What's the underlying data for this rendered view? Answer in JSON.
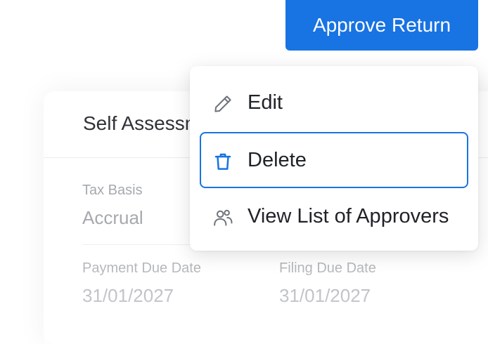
{
  "header": {
    "approve_label": "Approve Return"
  },
  "card": {
    "title": "Self Assessment",
    "fields": [
      {
        "label": "Tax Basis",
        "value": "Accrual"
      },
      {
        "label": "Payment Due Date",
        "value": "31/01/2027"
      },
      {
        "label": "Filing Due Date",
        "value": "31/01/2027"
      }
    ]
  },
  "menu": {
    "items": [
      {
        "label": "Edit",
        "icon": "pencil-icon",
        "active": false
      },
      {
        "label": "Delete",
        "icon": "trash-icon",
        "active": true
      },
      {
        "label": "View List of Approvers",
        "icon": "users-icon",
        "active": false
      }
    ]
  },
  "colors": {
    "accent": "#1873e3",
    "text": "#1f2227",
    "muted": "#a6a9ae"
  }
}
